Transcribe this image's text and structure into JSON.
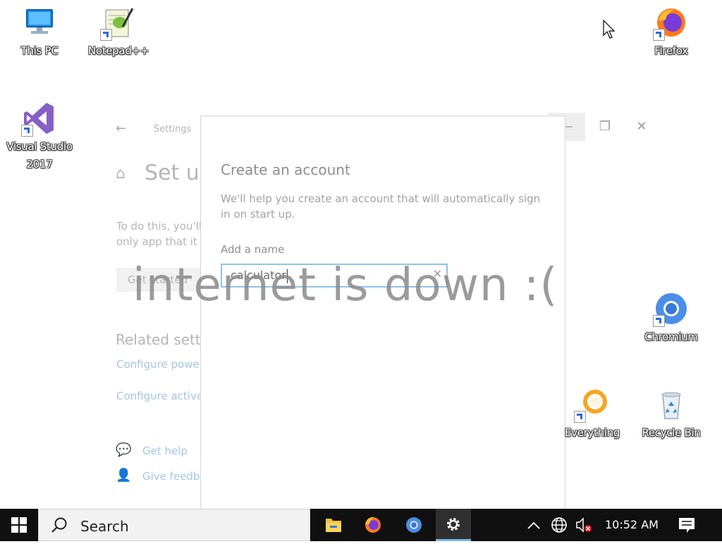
{
  "desktop": {
    "icons": [
      {
        "label": "This PC"
      },
      {
        "label": "Notepad++"
      },
      {
        "label": "Firefox"
      },
      {
        "label": "Visual Studio 2017"
      },
      {
        "label": "Chromium"
      },
      {
        "label": "Everything"
      },
      {
        "label": "Recycle Bin"
      }
    ]
  },
  "settings": {
    "breadcrumb": "Settings",
    "title": "Set up",
    "body_line1": "To do this, you'll",
    "body_line2": "only app that it c",
    "button_label": "Get started",
    "related_heading": "Related sett",
    "link1": "Configure power",
    "link2": "Configure active",
    "help_label": "Get help",
    "feedback_label": "Give feedback",
    "window_controls": {
      "minimize": "—",
      "restore": "❐",
      "close": "✕"
    }
  },
  "dialog": {
    "title": "Create an account",
    "description": "We'll help you create an account that will automatically sign in on start up.",
    "name_label": "Add a name",
    "name_value": "calculator"
  },
  "overlay_message": "internet is down :(",
  "taskbar": {
    "search_placeholder": "Search",
    "clock": "10:52 AM"
  }
}
